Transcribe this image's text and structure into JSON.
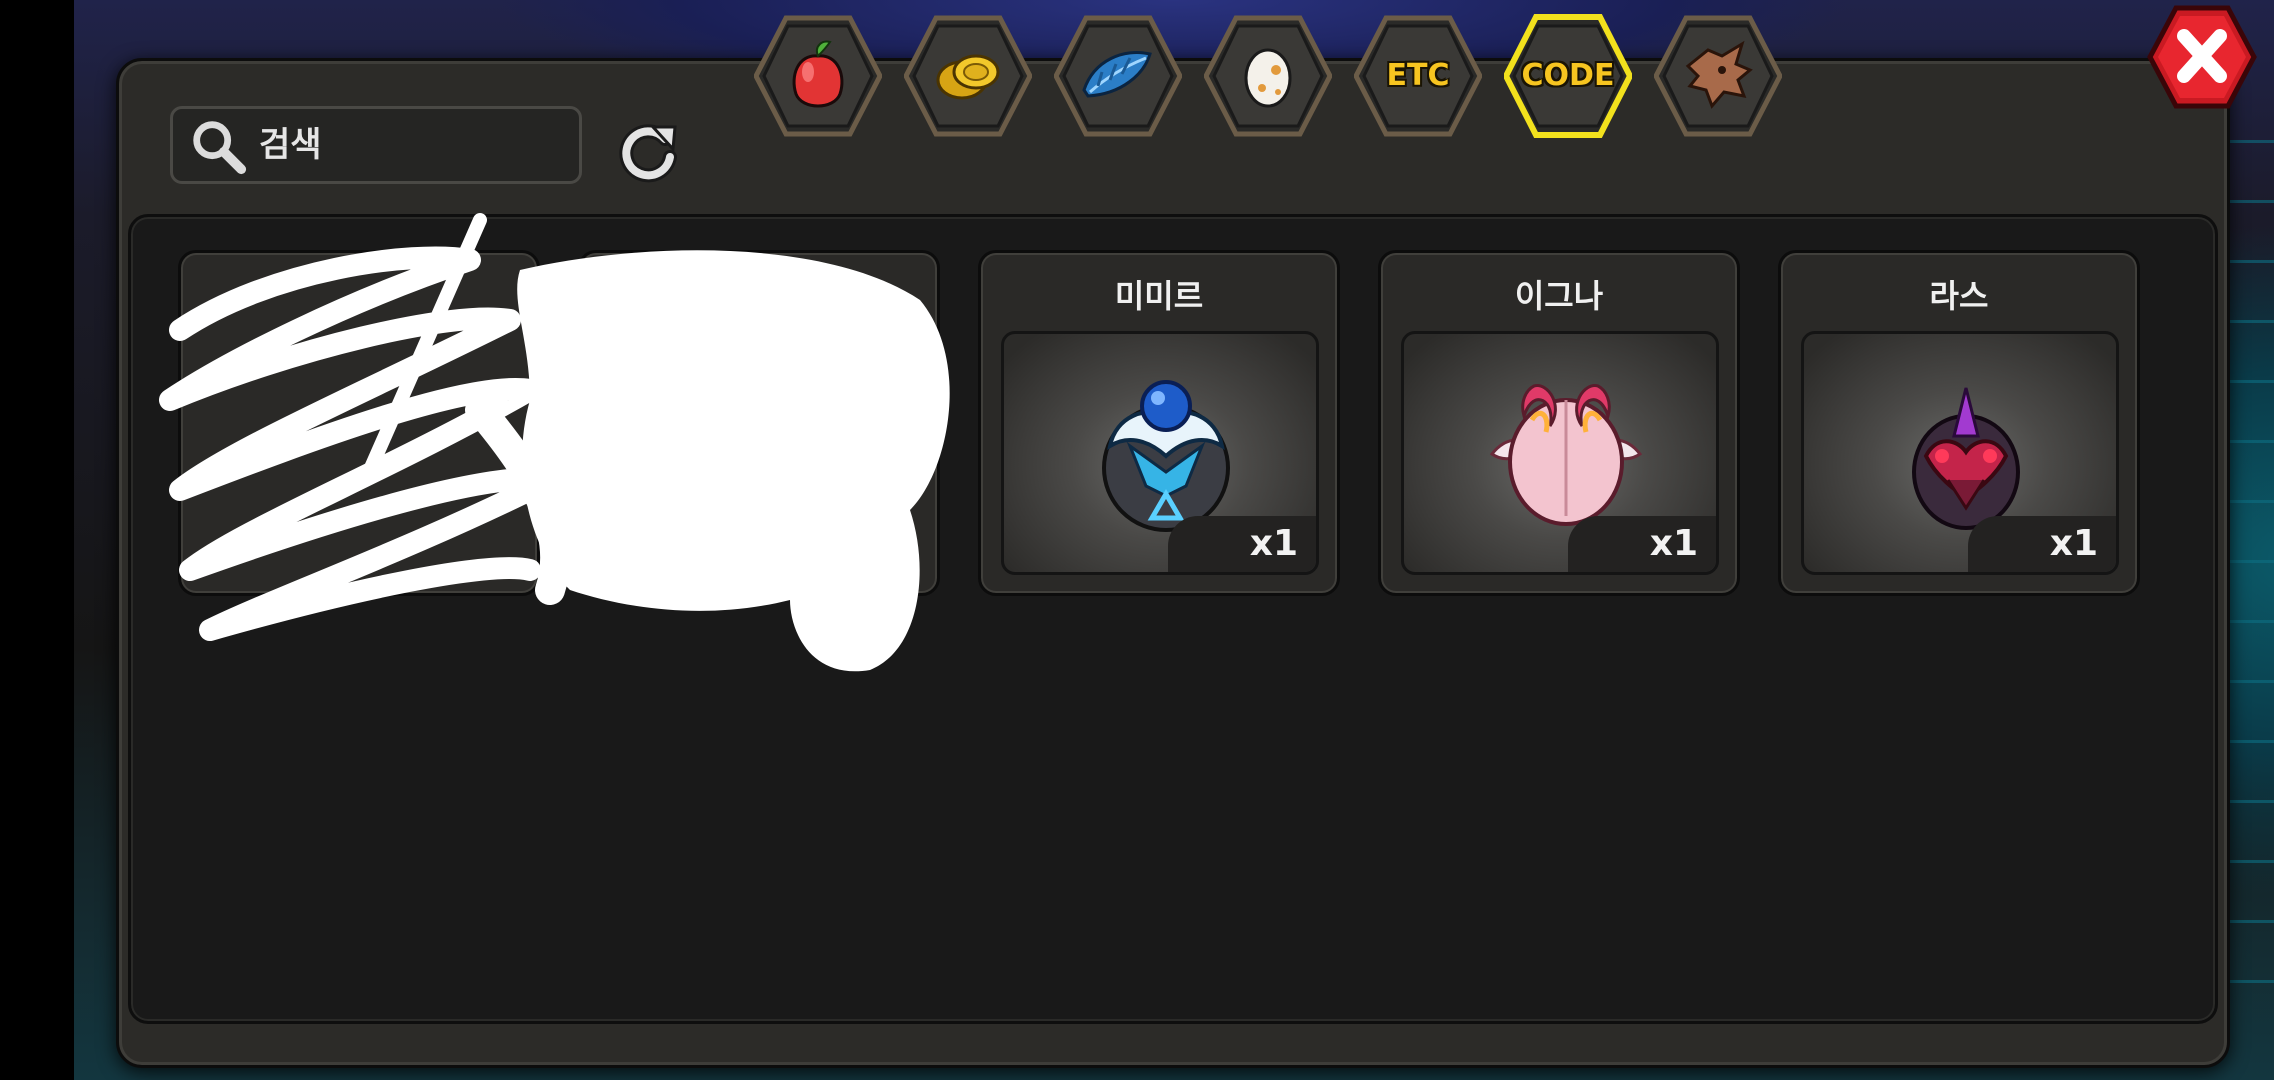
{
  "search": {
    "placeholder": "검색"
  },
  "tabs": [
    {
      "name": "fruit",
      "icon": "fruit-icon",
      "label": ""
    },
    {
      "name": "coin",
      "icon": "gold-coin-icon",
      "label": ""
    },
    {
      "name": "feather",
      "icon": "blue-feather-icon",
      "label": ""
    },
    {
      "name": "egg",
      "icon": "egg-icon",
      "label": ""
    },
    {
      "name": "etc",
      "icon": "",
      "label": "ETC"
    },
    {
      "name": "code",
      "icon": "",
      "label": "CODE",
      "selected": true
    },
    {
      "name": "dragon",
      "icon": "dragon-head-icon",
      "label": ""
    }
  ],
  "slots": [
    {
      "name": "미미르",
      "count": "x1",
      "icon": "mimir-egg-icon"
    },
    {
      "name": "이그나",
      "count": "x1",
      "icon": "igna-egg-icon"
    },
    {
      "name": "라스",
      "count": "x1",
      "icon": "ras-egg-icon"
    }
  ],
  "colors": {
    "selected_tab_border": "#f2e11d",
    "close_button": "#e8262f",
    "tab_text": "#f7c520"
  }
}
